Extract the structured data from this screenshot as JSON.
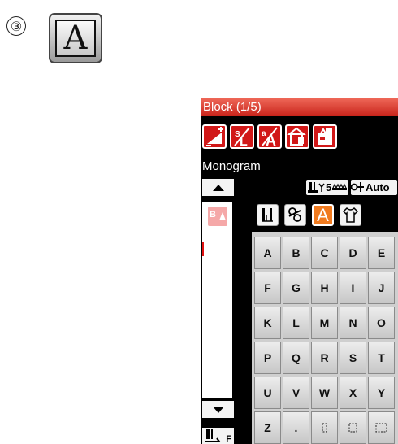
{
  "figure": {
    "step_number": "③",
    "key_letter": "A"
  },
  "screen": {
    "title": "Block (1/5)",
    "toolbar_icons": [
      "stitch-length-adjust-icon",
      "mirror-letter-icon",
      "letter-size-icon",
      "delete-icon",
      "memory-save-icon"
    ],
    "mode_label": "Monogram",
    "status": {
      "presser_foot_value": "5",
      "tension_label": "Auto"
    },
    "list": {
      "selected_item_label": "B"
    },
    "categories": {
      "selected_label": "A",
      "icons": [
        "needle-position-icon",
        "decorative-stitch-icon",
        "letter-font-icon",
        "garment-icon"
      ]
    },
    "alphabet_keys": [
      "A",
      "B",
      "C",
      "D",
      "E",
      "F",
      "G",
      "H",
      "I",
      "J",
      "K",
      "L",
      "M",
      "N",
      "O",
      "P",
      "Q",
      "R",
      "S",
      "T",
      "U",
      "V",
      "W",
      "X",
      "Y",
      "Z",
      ".",
      "",
      "",
      ""
    ],
    "footer": {
      "foot_label": "F"
    },
    "colors": {
      "title_bar": "#d8322a",
      "toolbar_button": "#d11818",
      "selected_category": "#f07a1e",
      "screen_background": "#000000"
    }
  }
}
